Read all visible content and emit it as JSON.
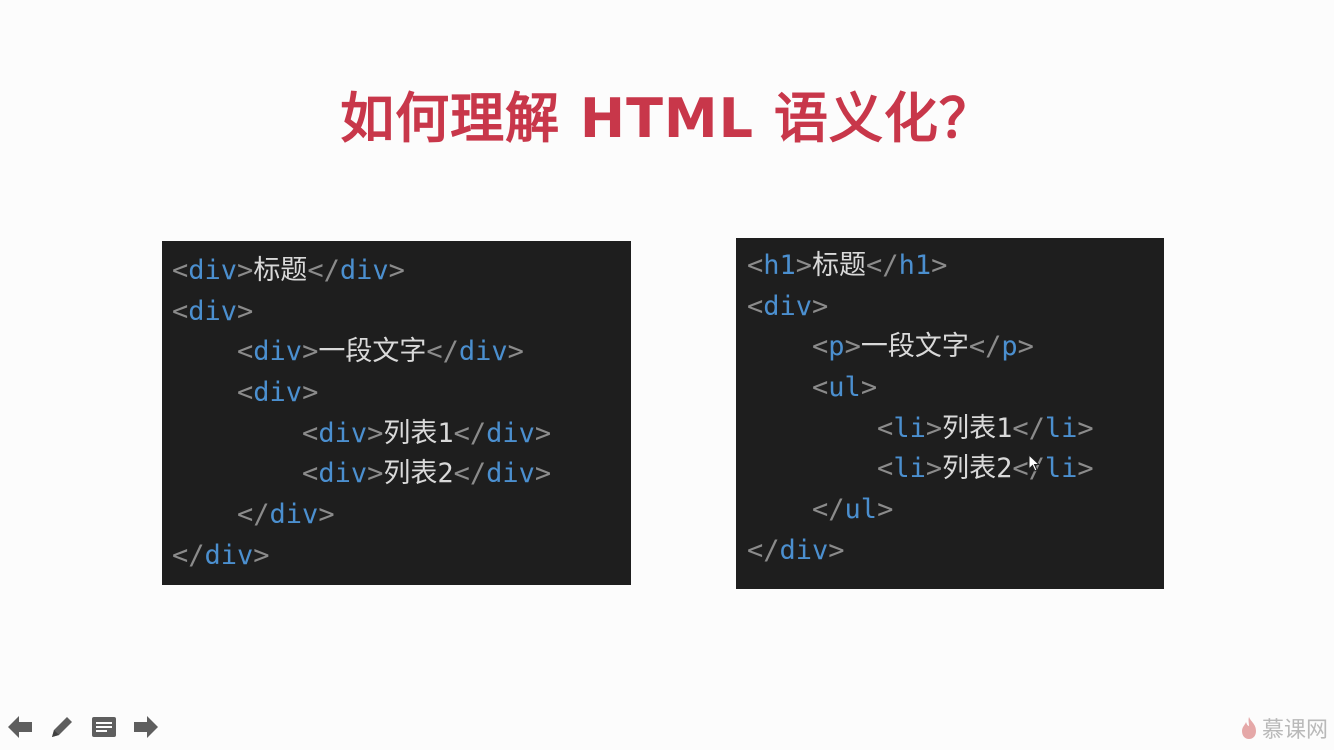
{
  "slide": {
    "title": "如何理解 HTML 语义化？"
  },
  "code_left": {
    "lines": [
      {
        "indent": "",
        "parts": [
          [
            "p",
            "<"
          ],
          [
            "t",
            "div"
          ],
          [
            "p",
            ">"
          ],
          [
            "x",
            "标题"
          ],
          [
            "p",
            "</"
          ],
          [
            "t",
            "div"
          ],
          [
            "p",
            ">"
          ]
        ]
      },
      {
        "indent": "",
        "parts": [
          [
            "p",
            "<"
          ],
          [
            "t",
            "div"
          ],
          [
            "p",
            ">"
          ]
        ]
      },
      {
        "indent": "    ",
        "parts": [
          [
            "p",
            "<"
          ],
          [
            "t",
            "div"
          ],
          [
            "p",
            ">"
          ],
          [
            "x",
            "一段文字"
          ],
          [
            "p",
            "</"
          ],
          [
            "t",
            "div"
          ],
          [
            "p",
            ">"
          ]
        ]
      },
      {
        "indent": "    ",
        "parts": [
          [
            "p",
            "<"
          ],
          [
            "t",
            "div"
          ],
          [
            "p",
            ">"
          ]
        ]
      },
      {
        "indent": "        ",
        "parts": [
          [
            "p",
            "<"
          ],
          [
            "t",
            "div"
          ],
          [
            "p",
            ">"
          ],
          [
            "x",
            "列表1"
          ],
          [
            "p",
            "</"
          ],
          [
            "t",
            "div"
          ],
          [
            "p",
            ">"
          ]
        ]
      },
      {
        "indent": "        ",
        "parts": [
          [
            "p",
            "<"
          ],
          [
            "t",
            "div"
          ],
          [
            "p",
            ">"
          ],
          [
            "x",
            "列表2"
          ],
          [
            "p",
            "</"
          ],
          [
            "t",
            "div"
          ],
          [
            "p",
            ">"
          ]
        ]
      },
      {
        "indent": "    ",
        "parts": [
          [
            "p",
            "</"
          ],
          [
            "t",
            "div"
          ],
          [
            "p",
            ">"
          ]
        ]
      },
      {
        "indent": "",
        "parts": [
          [
            "p",
            "</"
          ],
          [
            "t",
            "div"
          ],
          [
            "p",
            ">"
          ]
        ]
      }
    ]
  },
  "code_right": {
    "lines": [
      {
        "indent": "",
        "parts": [
          [
            "p",
            "<"
          ],
          [
            "t",
            "h1"
          ],
          [
            "p",
            ">"
          ],
          [
            "x",
            "标题"
          ],
          [
            "p",
            "</"
          ],
          [
            "t",
            "h1"
          ],
          [
            "p",
            ">"
          ]
        ]
      },
      {
        "indent": "",
        "parts": [
          [
            "p",
            "<"
          ],
          [
            "t",
            "div"
          ],
          [
            "p",
            ">"
          ]
        ]
      },
      {
        "indent": "    ",
        "parts": [
          [
            "p",
            "<"
          ],
          [
            "t",
            "p"
          ],
          [
            "p",
            ">"
          ],
          [
            "x",
            "一段文字"
          ],
          [
            "p",
            "</"
          ],
          [
            "t",
            "p"
          ],
          [
            "p",
            ">"
          ]
        ]
      },
      {
        "indent": "    ",
        "parts": [
          [
            "p",
            "<"
          ],
          [
            "t",
            "ul"
          ],
          [
            "p",
            ">"
          ]
        ]
      },
      {
        "indent": "        ",
        "parts": [
          [
            "p",
            "<"
          ],
          [
            "t",
            "li"
          ],
          [
            "p",
            ">"
          ],
          [
            "x",
            "列表1"
          ],
          [
            "p",
            "</"
          ],
          [
            "t",
            "li"
          ],
          [
            "p",
            ">"
          ]
        ]
      },
      {
        "indent": "        ",
        "parts": [
          [
            "p",
            "<"
          ],
          [
            "t",
            "li"
          ],
          [
            "p",
            ">"
          ],
          [
            "x",
            "列表2"
          ],
          [
            "p",
            "</"
          ],
          [
            "t",
            "li"
          ],
          [
            "p",
            ">"
          ]
        ]
      },
      {
        "indent": "    ",
        "parts": [
          [
            "p",
            "</"
          ],
          [
            "t",
            "ul"
          ],
          [
            "p",
            ">"
          ]
        ]
      },
      {
        "indent": "",
        "parts": [
          [
            "p",
            "</"
          ],
          [
            "t",
            "div"
          ],
          [
            "p",
            ">"
          ]
        ]
      }
    ]
  },
  "toolbar": {
    "items": [
      {
        "name": "previous-slide-button",
        "icon": "arrow-left-icon"
      },
      {
        "name": "pen-tool-button",
        "icon": "pencil-icon"
      },
      {
        "name": "slide-menu-button",
        "icon": "menu-icon"
      },
      {
        "name": "next-slide-button",
        "icon": "arrow-right-icon"
      }
    ]
  },
  "brand": {
    "label": "慕课网"
  },
  "colors": {
    "title": "#c8374a",
    "code_bg": "#1e1e1e",
    "tag": "#4b8fcf",
    "punct": "#8b8b8b",
    "text": "#d9d9d9"
  }
}
